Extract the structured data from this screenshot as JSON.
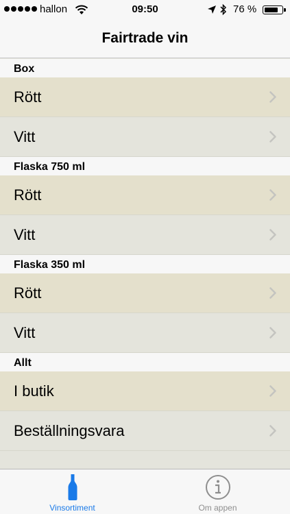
{
  "status_bar": {
    "carrier": "hallon",
    "time": "09:50",
    "battery_percent": "76 %",
    "battery_level": 0.76
  },
  "nav": {
    "title": "Fairtrade vin"
  },
  "sections": [
    {
      "header": "Box",
      "rows": [
        "Rött",
        "Vitt"
      ]
    },
    {
      "header": "Flaska 750 ml",
      "rows": [
        "Rött",
        "Vitt"
      ]
    },
    {
      "header": "Flaska 350 ml",
      "rows": [
        "Rött",
        "Vitt"
      ]
    },
    {
      "header": "Allt",
      "rows": [
        "I butik",
        "Beställningsvara"
      ]
    }
  ],
  "tabs": [
    {
      "label": "Vinsortiment",
      "icon": "wine-bottle-icon",
      "selected": true
    },
    {
      "label": "Om appen",
      "icon": "info-icon",
      "selected": false
    }
  ],
  "colors": {
    "accent": "#1a7ae8",
    "row_odd": "#e4e0cc",
    "row_even": "#e4e4dc",
    "bar_background": "#f7f7f7",
    "inactive_tab": "#8e8e8e"
  }
}
